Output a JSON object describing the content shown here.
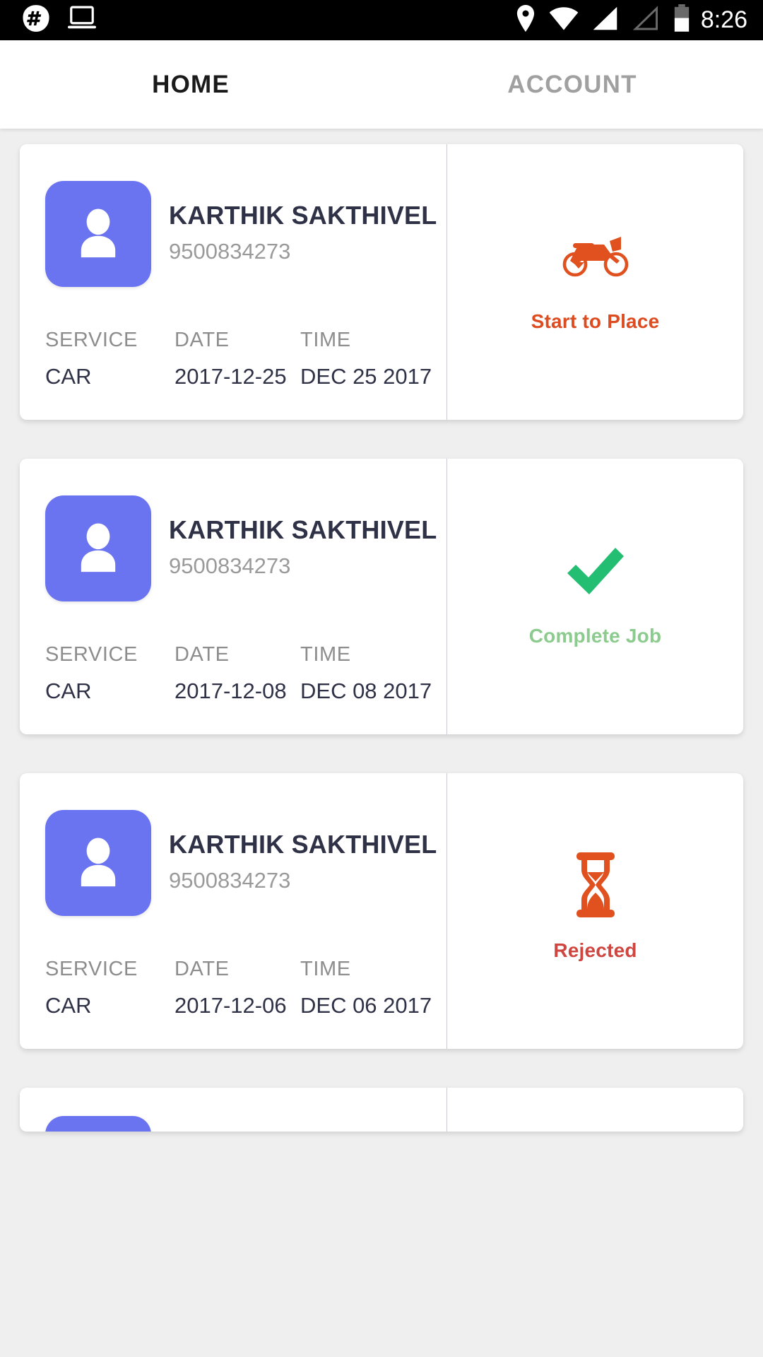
{
  "statusbar": {
    "time": "8:26",
    "icons_left": [
      "hashtag-app-icon",
      "laptop-icon"
    ],
    "icons_right": [
      "location-pin-icon",
      "wifi-icon",
      "signal-full-icon",
      "signal-empty-icon",
      "battery-icon"
    ]
  },
  "tabs": [
    {
      "label": "HOME",
      "active": true
    },
    {
      "label": "ACCOUNT",
      "active": false
    }
  ],
  "columns": {
    "service": "SERVICE",
    "date": "DATE",
    "time": "TIME"
  },
  "colors": {
    "avatar": "#6B74F0",
    "start_to_place": "#DD4B20",
    "complete_job_text": "#8CCB8E",
    "complete_job_icon": "#23BE72",
    "rejected_text": "#CF453F",
    "rejected_icon": "#E0511F",
    "name": "#2F3246",
    "label": "#8D8D8D",
    "background": "#EFEFEF"
  },
  "jobs": [
    {
      "name": "KARTHIK SAKTHIVEL",
      "phone": "9500834273",
      "service": "CAR",
      "date": "2017-12-25",
      "time": "DEC 25 2017",
      "action_label": "Start to Place",
      "action_icon": "motorcycle-icon",
      "action_color": "#DD4B20"
    },
    {
      "name": "KARTHIK SAKTHIVEL",
      "phone": "9500834273",
      "service": "CAR",
      "date": "2017-12-08",
      "time": "DEC 08 2017",
      "action_label": "Complete Job",
      "action_icon": "checkmark-icon",
      "action_color": "#8CCB8E"
    },
    {
      "name": "KARTHIK SAKTHIVEL",
      "phone": "9500834273",
      "service": "CAR",
      "date": "2017-12-06",
      "time": "DEC 06 2017",
      "action_label": "Rejected",
      "action_icon": "hourglass-icon",
      "action_color": "#CF453F"
    }
  ]
}
